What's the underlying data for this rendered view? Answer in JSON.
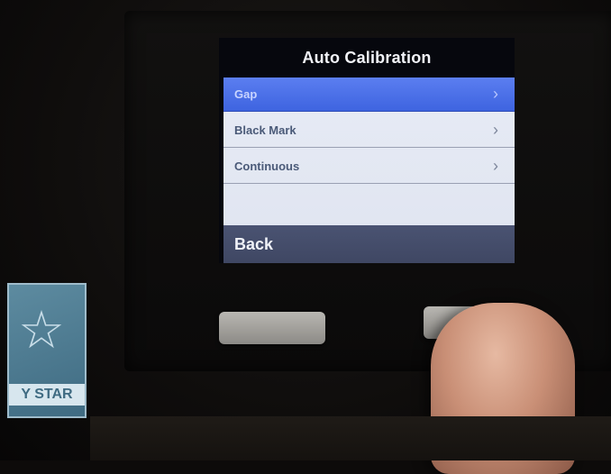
{
  "screen": {
    "title": "Auto Calibration",
    "menu_items": [
      {
        "label": "Gap",
        "selected": true
      },
      {
        "label": "Black Mark",
        "selected": false
      },
      {
        "label": "Continuous",
        "selected": false
      }
    ],
    "back_label": "Back"
  },
  "sticker": {
    "text": "Y STAR"
  },
  "icons": {
    "chevron": "chevron-right-icon",
    "star": "star-icon"
  },
  "colors": {
    "selected": "#3e64e0",
    "menu_bg": "#e2e7f3",
    "back_bar": "#454e6b"
  }
}
